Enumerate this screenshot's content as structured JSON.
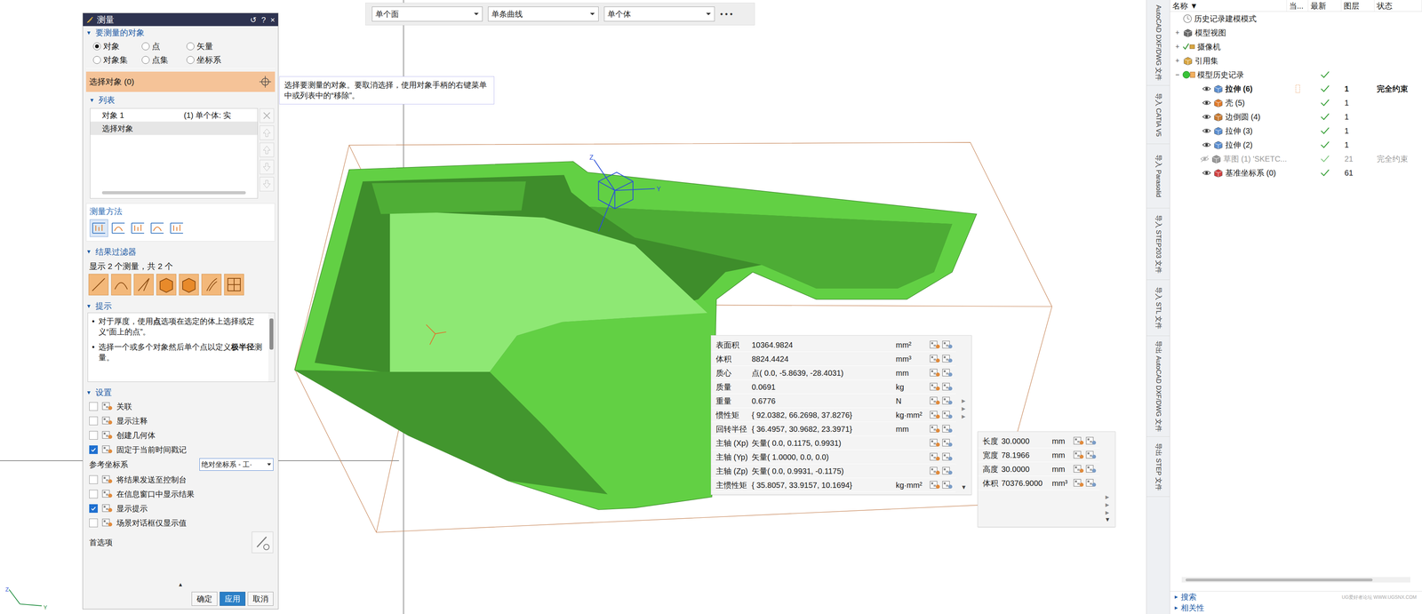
{
  "toolbar": {
    "filters": [
      "单个面",
      "单条曲线",
      "单个体"
    ],
    "more": "• • •"
  },
  "glyphs": {
    "collapse": "▼",
    "bullet": "•",
    "up": "▲",
    "expand": "▸"
  },
  "dialog": {
    "title": "测量",
    "controls": [
      "↺",
      "?",
      "×"
    ],
    "objects": {
      "title": "要测量的对象",
      "radios": [
        {
          "label": "对象",
          "selected": true
        },
        {
          "label": "点",
          "selected": false
        },
        {
          "label": "矢量",
          "selected": false
        },
        {
          "label": "对象集",
          "selected": false
        },
        {
          "label": "点集",
          "selected": false
        },
        {
          "label": "坐标系",
          "selected": false
        }
      ]
    },
    "select_bar": "选择对象 (0)",
    "list": {
      "title": "列表",
      "rows": [
        {
          "cells": [
            "对象 1",
            "(1) 单个体: 实"
          ],
          "selected": false
        },
        {
          "cells": [
            "选择对象",
            ""
          ],
          "selected": true
        }
      ]
    },
    "method": {
      "title": "测量方法"
    },
    "filter": {
      "title": "结果过滤器",
      "summary": "显示 2 个测量，共 2 个"
    },
    "hints": {
      "title": "提示",
      "items": [
        [
          {
            "text": "对于厚度，使用",
            "bold": false
          },
          {
            "text": "点",
            "bold": true
          },
          {
            "text": "选项在选定的体上选择或定义“面上的点”。",
            "bold": false
          }
        ],
        [
          {
            "text": "选择一个或多个对象然后单个点以定义",
            "bold": false
          },
          {
            "text": "极半径",
            "bold": true
          },
          {
            "text": "测量。",
            "bold": false
          }
        ]
      ]
    },
    "settings": {
      "title": "设置",
      "items": [
        {
          "kind": "checkbox",
          "label": "关联",
          "checked": false
        },
        {
          "kind": "checkbox",
          "label": "显示注释",
          "checked": false
        },
        {
          "kind": "checkbox",
          "label": "创建几何体",
          "checked": false
        },
        {
          "kind": "checkbox",
          "label": "固定于当前时间戳记",
          "checked": true
        },
        {
          "kind": "select",
          "label": "参考坐标系",
          "value": "绝对坐标系 - 工·"
        },
        {
          "kind": "checkbox",
          "label": "将结果发送至控制台",
          "checked": false
        },
        {
          "kind": "checkbox",
          "label": "在信息窗口中显示结果",
          "checked": false
        },
        {
          "kind": "checkbox",
          "label": "显示提示",
          "checked": true
        },
        {
          "kind": "checkbox",
          "label": "场景对话框仅显示值",
          "checked": false
        },
        {
          "kind": "preferences",
          "label": "首选项"
        }
      ]
    },
    "buttons": [
      {
        "label": "确定",
        "primary": false
      },
      {
        "label": "应用",
        "primary": true
      },
      {
        "label": "取消",
        "primary": false
      }
    ]
  },
  "tooltip": "选择要测量的对象。要取消选择，使用对象手柄的右键菜单中或列表中的“移除”。",
  "view": {
    "csys_labels": [
      "Z",
      "Y"
    ],
    "corner_labels": [
      "Z",
      "Y"
    ]
  },
  "results_body": {
    "rows": [
      {
        "label": "表面积",
        "value": "10364.9824",
        "unit": "mm²"
      },
      {
        "label": "体积",
        "value": "8824.4424",
        "unit": "mm³"
      },
      {
        "label": "质心",
        "value": "点( 0.0, -5.8639, -28.4031)",
        "unit": "mm"
      },
      {
        "label": "质量",
        "value": "0.0691",
        "unit": "kg"
      },
      {
        "label": "重量",
        "value": "0.6776",
        "unit": "N"
      },
      {
        "label": "惯性矩",
        "value": "{ 92.0382, 66.2698, 37.8276}",
        "unit": "kg·mm²"
      },
      {
        "label": "回转半径",
        "value": "{ 36.4957, 30.9682, 23.3971}",
        "unit": "mm"
      },
      {
        "label": "主轴 (Xp)",
        "value": "矢量( 0.0, 0.1175, 0.9931)",
        "unit": ""
      },
      {
        "label": "主轴 (Yp)",
        "value": "矢量( 1.0000, 0.0, 0.0)",
        "unit": ""
      },
      {
        "label": "主轴 (Zp)",
        "value": "矢量( 0.0, 0.9931, -0.1175)",
        "unit": ""
      },
      {
        "label": "主惯性矩",
        "value": "{ 35.8057, 33.9157, 10.1694}",
        "unit": "kg·mm²"
      }
    ],
    "side_arrows": [
      "►",
      "►",
      "►"
    ],
    "menu": "▾"
  },
  "results_box": {
    "rows": [
      {
        "label": "长度",
        "value": "30.0000",
        "unit": "mm"
      },
      {
        "label": "宽度",
        "value": "78.1966",
        "unit": "mm"
      },
      {
        "label": "高度",
        "value": "30.0000",
        "unit": "mm"
      },
      {
        "label": "体积",
        "value": "70376.9000",
        "unit": "mm³"
      }
    ],
    "side_arrows": [
      "►",
      "►",
      "►"
    ],
    "menu": "▾"
  },
  "side_strip": [
    "AutoCAD DXF/DWG 文件",
    "导入 CATIA V5",
    "导入 Parasolid",
    "导入 STEP203 文件",
    "导入 STL 文件",
    "导出 AutoCAD DXF/DWG 文件",
    "导出 STEP 文件"
  ],
  "navigator": {
    "columns": [
      "名称 ▼",
      "当...",
      "最新",
      "图层",
      "状态"
    ],
    "items": [
      {
        "label": "历史记录建模模式",
        "level": 0,
        "expander": "",
        "kind": "clock",
        "eye": false,
        "latest": false,
        "layer": "",
        "status": "",
        "bold": false,
        "greyed": false
      },
      {
        "label": "模型视图",
        "level": 0,
        "expander": "+",
        "kind": "view",
        "eye": false,
        "latest": false,
        "layer": "",
        "status": "",
        "bold": false,
        "greyed": false
      },
      {
        "label": "摄像机",
        "level": 0,
        "expander": "+",
        "kind": "camera",
        "eye": false,
        "latest": false,
        "layer": "",
        "status": "",
        "bold": false,
        "greyed": false
      },
      {
        "label": "引用集",
        "level": 0,
        "expander": "+",
        "kind": "folder",
        "eye": false,
        "latest": false,
        "layer": "",
        "status": "",
        "bold": false,
        "greyed": false
      },
      {
        "label": "模型历史记录",
        "level": 0,
        "expander": "−",
        "kind": "history",
        "eye": false,
        "latest": true,
        "layer": "",
        "status": "",
        "bold": false,
        "greyed": false
      },
      {
        "label": "拉伸 (6)",
        "level": 1,
        "expander": "",
        "kind": "extrude",
        "eye": true,
        "latest": true,
        "layer": "1",
        "status": "完全约束",
        "bold": true,
        "greyed": false
      },
      {
        "label": "壳 (5)",
        "level": 1,
        "expander": "",
        "kind": "shell",
        "eye": true,
        "latest": true,
        "layer": "1",
        "status": "",
        "bold": false,
        "greyed": false
      },
      {
        "label": "边倒圆 (4)",
        "level": 1,
        "expander": "",
        "kind": "blend",
        "eye": true,
        "latest": true,
        "layer": "1",
        "status": "",
        "bold": false,
        "greyed": false
      },
      {
        "label": "拉伸 (3)",
        "level": 1,
        "expander": "",
        "kind": "extrude",
        "eye": true,
        "latest": true,
        "layer": "1",
        "status": "",
        "bold": false,
        "greyed": false
      },
      {
        "label": "拉伸 (2)",
        "level": 1,
        "expander": "",
        "kind": "extrude",
        "eye": true,
        "latest": true,
        "layer": "1",
        "status": "",
        "bold": false,
        "greyed": false
      },
      {
        "label": "草图 (1) 'SKETC...",
        "level": 1,
        "expander": "",
        "kind": "sketch",
        "eye": true,
        "latest": true,
        "layer": "21",
        "status": "完全约束",
        "bold": false,
        "greyed": true
      },
      {
        "label": "基准坐标系 (0)",
        "level": 1,
        "expander": "",
        "kind": "datum",
        "eye": true,
        "latest": true,
        "layer": "61",
        "status": "",
        "bold": false,
        "greyed": false
      }
    ],
    "bottom": [
      "搜索",
      "相关性"
    ]
  },
  "watermark": "UG爱好者论坛 WWW.UGSNX.COM"
}
